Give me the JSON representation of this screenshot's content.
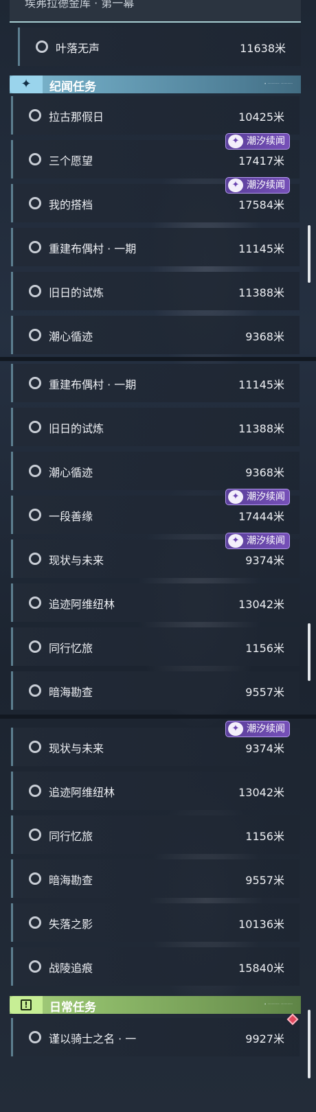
{
  "section1": {
    "top_title": "埃弗拉德金库 · 第一幕",
    "first_item": {
      "name": "叶落无声",
      "distance": "11638米"
    },
    "header": {
      "title": "纪闻任务",
      "icon": "sparkle-icon",
      "subtext": "• ········· ·········"
    },
    "items": [
      {
        "name": "拉古那假日",
        "distance": "10425米"
      },
      {
        "name": "三个愿望",
        "distance": "17417米",
        "badge": "潮汐续闻"
      },
      {
        "name": "我的搭档",
        "distance": "17584米",
        "badge": "潮汐续闻"
      },
      {
        "name": "重建布偶村 · 一期",
        "distance": "11145米"
      },
      {
        "name": "旧日的试炼",
        "distance": "11388米"
      },
      {
        "name": "潮心循迹",
        "distance": "9368米"
      }
    ]
  },
  "section2": {
    "items": [
      {
        "name": "重建布偶村 · 一期",
        "distance": "11145米"
      },
      {
        "name": "旧日的试炼",
        "distance": "11388米"
      },
      {
        "name": "潮心循迹",
        "distance": "9368米"
      },
      {
        "name": "一段善缘",
        "distance": "17444米",
        "badge": "潮汐续闻"
      },
      {
        "name": "现状与未来",
        "distance": "9374米",
        "badge": "潮汐续闻"
      },
      {
        "name": "追迹阿维纽林",
        "distance": "13042米"
      },
      {
        "name": "同行忆旅",
        "distance": "1156米"
      },
      {
        "name": "暗海勘查",
        "distance": "9557米"
      }
    ]
  },
  "section3": {
    "items": [
      {
        "name": "现状与未来",
        "distance": "9374米",
        "badge": "潮汐续闻"
      },
      {
        "name": "追迹阿维纽林",
        "distance": "13042米"
      },
      {
        "name": "同行忆旅",
        "distance": "1156米"
      },
      {
        "name": "暗海勘查",
        "distance": "9557米"
      },
      {
        "name": "失落之影",
        "distance": "10136米"
      },
      {
        "name": "战陵追痕",
        "distance": "15840米"
      }
    ],
    "header": {
      "title": "日常任务",
      "icon": "exclamation-box-icon",
      "subtext": "• ········· ·········"
    },
    "daily_items": [
      {
        "name": "谨以骑士之名 · 一",
        "distance": "9927米"
      }
    ]
  },
  "colors": {
    "accent_blue": "#7fb8cf",
    "accent_green": "#a7cf7e",
    "badge_purple": "#6a48ac",
    "row_border": "#5d7f90"
  }
}
